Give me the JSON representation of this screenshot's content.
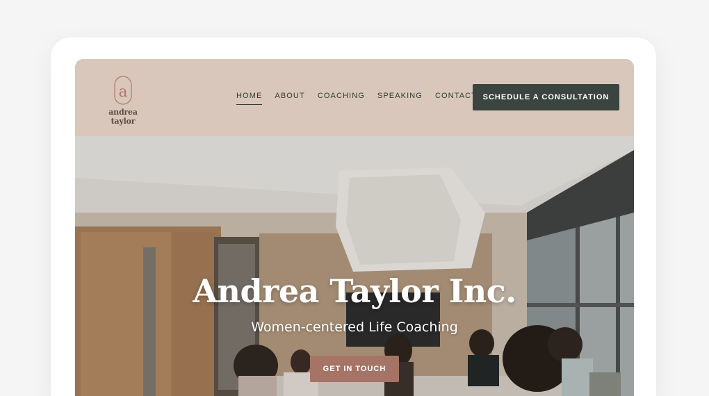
{
  "brand": {
    "name": "andrea taylor",
    "mark_letter": "a"
  },
  "nav": {
    "items": [
      {
        "label": "HOME",
        "active": true
      },
      {
        "label": "ABOUT",
        "active": false
      },
      {
        "label": "COACHING",
        "active": false
      },
      {
        "label": "SPEAKING",
        "active": false
      },
      {
        "label": "CONTACT",
        "active": false
      }
    ],
    "cta_label": "SCHEDULE A CONSULTATION"
  },
  "hero": {
    "title": "Andrea Taylor Inc.",
    "subtitle": "Women-centered Life Coaching",
    "button_label": "GET IN TOUCH",
    "image": "office-meeting-photo"
  },
  "colors": {
    "header_bg": "#d8c7ba",
    "cta_bg": "#3b4540",
    "accent": "#a67466",
    "page_bg": "#f5f5f6"
  }
}
